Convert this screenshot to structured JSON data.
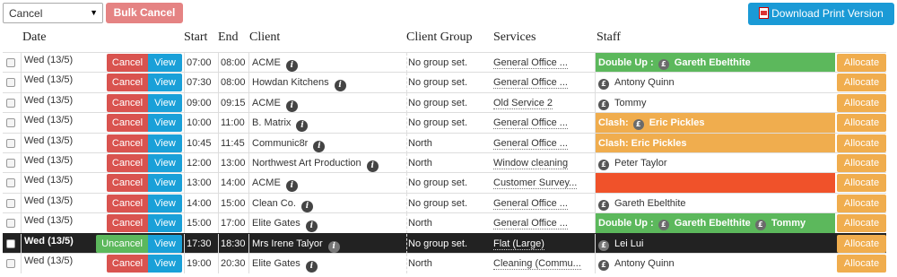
{
  "toolbar": {
    "select_value": "Cancel",
    "bulk_cancel_label": "Bulk Cancel",
    "print_label": "Download Print Version"
  },
  "columns": {
    "date": "Date",
    "start": "Start",
    "end": "End",
    "client": "Client",
    "group": "Client Group",
    "services": "Services",
    "staff": "Staff"
  },
  "labels": {
    "cancel": "Cancel",
    "uncancel": "Uncancel",
    "view": "View",
    "allocate": "Allocate"
  },
  "rows": [
    {
      "date": "Wed (13/5)",
      "start": "07:00",
      "end": "08:00",
      "client": "ACME",
      "group": "No group set.",
      "service": "General Office ...",
      "staff_prefix": "Double Up : ",
      "staff": [
        "Gareth Ebelthite"
      ],
      "staff_status": "green",
      "cancelled": false
    },
    {
      "date": "Wed (13/5)",
      "start": "07:30",
      "end": "08:00",
      "client": "Howdan Kitchens",
      "group": "No group set.",
      "service": "General Office ...",
      "staff_prefix": "",
      "staff": [
        "Antony Quinn"
      ],
      "staff_status": "normal",
      "cancelled": false
    },
    {
      "date": "Wed (13/5)",
      "start": "09:00",
      "end": "09:15",
      "client": "ACME",
      "group": "No group set.",
      "service": "Old Service 2",
      "staff_prefix": "",
      "staff": [
        "Tommy"
      ],
      "staff_status": "normal",
      "cancelled": false
    },
    {
      "date": "Wed (13/5)",
      "start": "10:00",
      "end": "11:00",
      "client": "B. Matrix",
      "group": "No group set.",
      "service": "General Office ...",
      "staff_prefix": "Clash: ",
      "staff": [
        "Eric Pickles"
      ],
      "staff_status": "orange",
      "cancelled": false
    },
    {
      "date": "Wed (13/5)",
      "start": "10:45",
      "end": "11:45",
      "client": "Communic8r",
      "group": "North",
      "service": "General Office ...",
      "staff_prefix": "Clash: Eric Pickles",
      "staff": [],
      "staff_status": "orange",
      "cancelled": false
    },
    {
      "date": "Wed (13/5)",
      "start": "12:00",
      "end": "13:00",
      "client": "Northwest Art Production",
      "group": "North",
      "service": "Window cleaning",
      "staff_prefix": "",
      "staff": [
        "Peter Taylor"
      ],
      "staff_status": "normal",
      "cancelled": false
    },
    {
      "date": "Wed (13/5)",
      "start": "13:00",
      "end": "14:00",
      "client": "ACME",
      "group": "No group set.",
      "service": "Customer Survey...",
      "staff_prefix": "",
      "staff": [],
      "staff_status": "red",
      "cancelled": false
    },
    {
      "date": "Wed (13/5)",
      "start": "14:00",
      "end": "15:00",
      "client": "Clean Co.",
      "group": "No group set.",
      "service": "General Office ...",
      "staff_prefix": "",
      "staff": [
        "Gareth Ebelthite"
      ],
      "staff_status": "normal",
      "cancelled": false
    },
    {
      "date": "Wed (13/5)",
      "start": "15:00",
      "end": "17:00",
      "client": "Elite Gates",
      "group": "North",
      "service": "General Office ...",
      "staff_prefix": "Double Up : ",
      "staff": [
        "Gareth Ebelthite",
        "Tommy"
      ],
      "staff_status": "green",
      "cancelled": false
    },
    {
      "date": "Wed (13/5)",
      "start": "17:30",
      "end": "18:30",
      "client": "Mrs Irene Talyor",
      "group": "No group set.",
      "service": "Flat (Large)",
      "staff_prefix": "",
      "staff": [
        "Lei Lui"
      ],
      "staff_status": "normal",
      "cancelled": true
    },
    {
      "date": "Wed (13/5)",
      "start": "19:00",
      "end": "20:30",
      "client": "Elite Gates",
      "group": "North",
      "service": "Cleaning (Commu...",
      "staff_prefix": "",
      "staff": [
        "Antony Quinn"
      ],
      "staff_status": "normal",
      "cancelled": false
    }
  ]
}
